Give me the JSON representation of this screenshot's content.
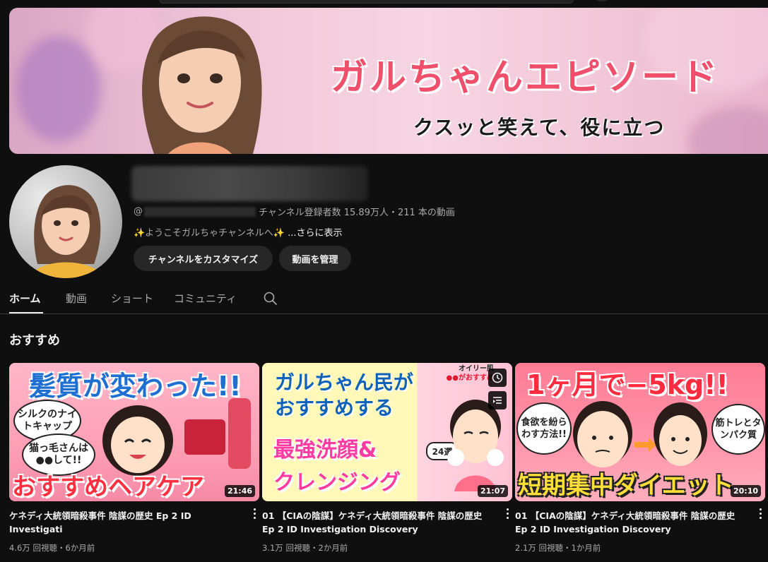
{
  "banner": {
    "title": "ガルちゃんエピソード",
    "subtitle": "クスッと笑えて、役に立つ"
  },
  "channel": {
    "handle_prefix": "@",
    "stats": "チャンネル登録者数 15.89万人・211 本の動画",
    "description": "✨ようこそガルちゃチャンネルへ✨",
    "more_label": "...さらに表示",
    "customize_button": "チャンネルをカスタマイズ",
    "manage_button": "動画を管理"
  },
  "tabs": [
    {
      "label": "ホーム",
      "active": true
    },
    {
      "label": "動画",
      "active": false
    },
    {
      "label": "ショート",
      "active": false
    },
    {
      "label": "コミュニティ",
      "active": false
    }
  ],
  "section": {
    "title": "おすすめ"
  },
  "videos": [
    {
      "duration": "21:46",
      "title": "ケネディ大統領暗殺事件 陰謀の歴史 Ep 2 ID Investigati",
      "meta": "4.6万 回視聴・6か月前",
      "thumb": {
        "headline": "髪質が変わった!!",
        "bubble_1": "シルクのナイトキャップ",
        "bubble_2": "猫っ毛さんは●●して!!",
        "bottom": "おすすめヘアケア"
      }
    },
    {
      "duration": "21:07",
      "title": "01 【CIAの陰謀】ケネディ大統領暗殺事件 陰謀の歴史 Ep 2 ID Investigation Discovery",
      "meta": "3.1万 回視聴・2か月前",
      "thumb": {
        "line_1": "ガルちゃん民が",
        "line_2": "おすすめする",
        "line_3": "最強洗顔&",
        "line_4": "クレンジング",
        "badge": "24選",
        "corner_1": "オイリー肌",
        "corner_2": "●●がおすすめ"
      }
    },
    {
      "duration": "20:10",
      "title": "01 【CIAの陰謀】ケネディ大統領暗殺事件 陰謀の歴史 Ep 2 ID Investigation Discovery",
      "meta": "2.1万 回視聴・1か月前",
      "thumb": {
        "headline": "1ヶ月で−5kg!!",
        "bubble_1": "食欲を紛らわす方法!!",
        "bubble_2": "筋トレとタンパク質",
        "bottom": "短期集中ダイエット"
      }
    }
  ],
  "icons": {
    "search": "search-icon",
    "watch_later": "clock-icon",
    "add_to_queue": "queue-icon",
    "more": "kebab-icon"
  }
}
